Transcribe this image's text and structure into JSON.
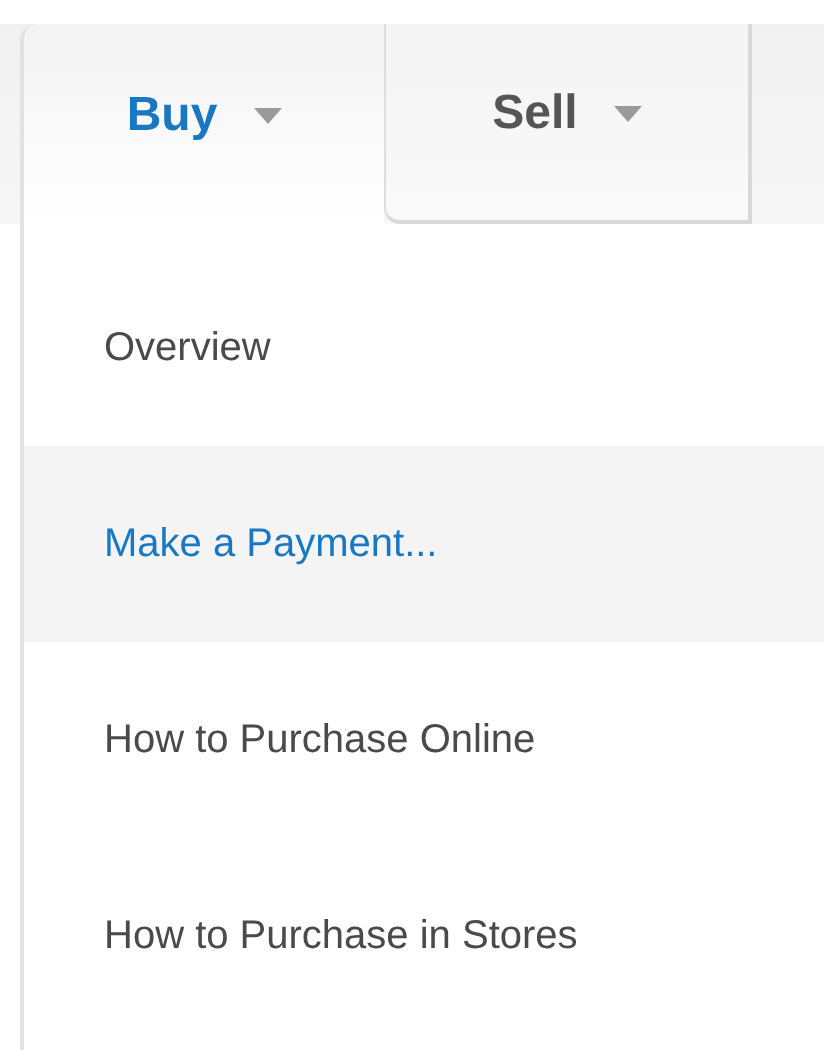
{
  "tabs": [
    {
      "label": "Buy",
      "selected": true
    },
    {
      "label": "Sell",
      "selected": false
    }
  ],
  "menu": {
    "items": [
      {
        "label": "Overview",
        "selected": false
      },
      {
        "label": "Make a Payment...",
        "selected": true
      },
      {
        "label": "How to Purchase Online",
        "selected": false
      },
      {
        "label": "How to Purchase in Stores",
        "selected": false
      }
    ]
  }
}
